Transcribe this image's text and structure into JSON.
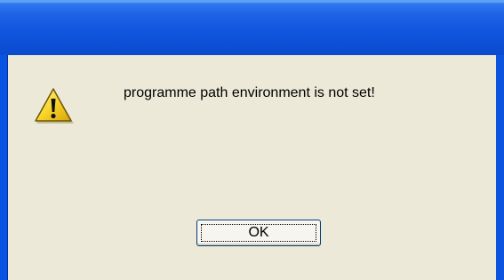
{
  "dialog": {
    "icon": "warning-icon",
    "message": "programme path environment is not set!",
    "ok_label": "OK"
  },
  "colors": {
    "titlebar": "#0a54e3",
    "client_bg": "#ece9d8",
    "icon_yellow": "#f7d62c"
  }
}
